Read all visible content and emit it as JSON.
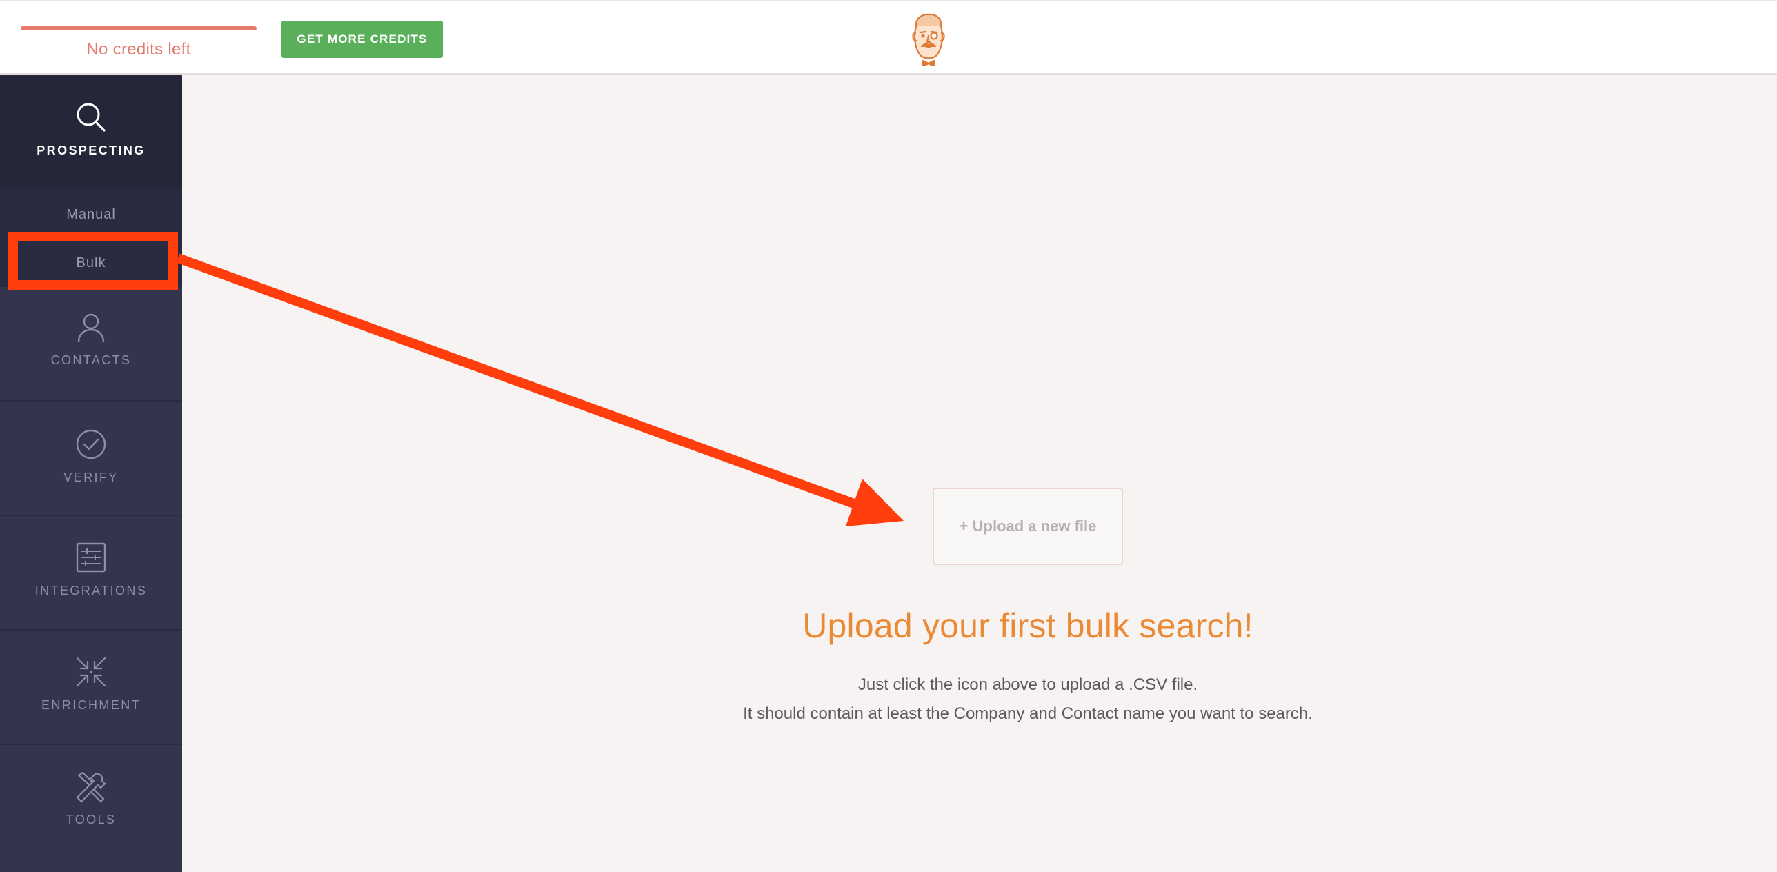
{
  "header": {
    "credits_status": "No credits left",
    "get_credits_label": "GET MORE CREDITS",
    "credit_color": "#e3786c",
    "button_color": "#5ab05a"
  },
  "sidebar": {
    "sections": [
      {
        "label": "PROSPECTING",
        "icon": "search-icon",
        "active": true
      },
      {
        "label": "CONTACTS",
        "icon": "person-icon"
      },
      {
        "label": "VERIFY",
        "icon": "check-circle-icon"
      },
      {
        "label": "INTEGRATIONS",
        "icon": "sliders-icon"
      },
      {
        "label": "ENRICHMENT",
        "icon": "compress-arrows-icon"
      },
      {
        "label": "TOOLS",
        "icon": "wrench-screwdriver-icon"
      }
    ],
    "subnav": [
      {
        "label": "Manual"
      },
      {
        "label": "Bulk",
        "selected": true
      }
    ]
  },
  "main": {
    "upload_label": "+ Upload a new file",
    "headline": "Upload your first bulk search!",
    "description_line1": "Just click the icon above to upload a .CSV file.",
    "description_line2": "It should contain at least the Company and Contact name you want to search.",
    "headline_color": "#eb8a34"
  },
  "annotation": {
    "color": "#ff3d0d"
  }
}
